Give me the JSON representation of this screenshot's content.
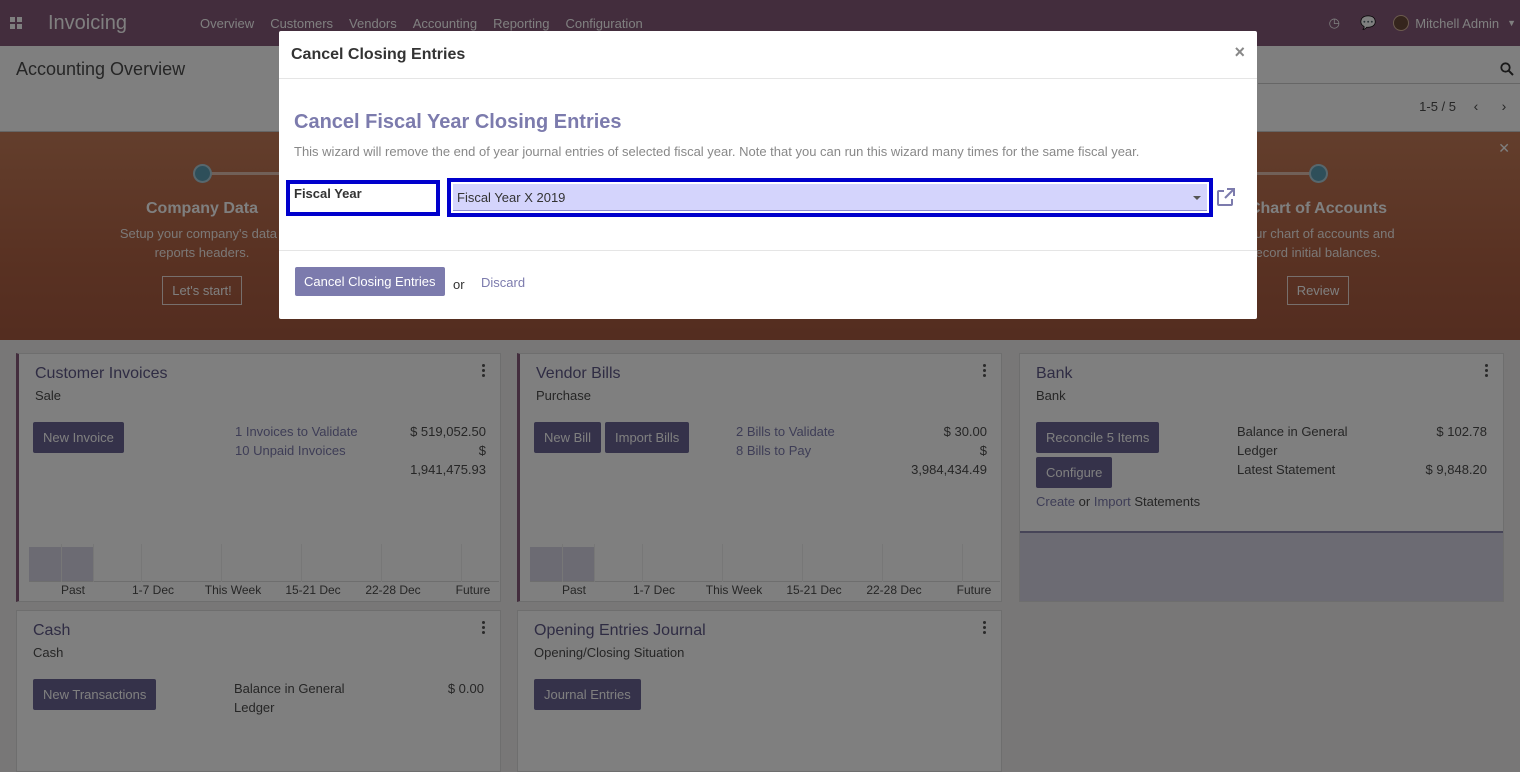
{
  "navbar": {
    "brand": "Invoicing",
    "menu": [
      "Overview",
      "Customers",
      "Vendors",
      "Accounting",
      "Reporting",
      "Configuration"
    ],
    "user_name": "Mitchell Admin",
    "icons": [
      "apps-grid-icon",
      "clock-icon",
      "chat-icon"
    ]
  },
  "control_panel": {
    "breadcrumb": "Accounting Overview",
    "pager": "1-5 / 5"
  },
  "banner": {
    "steps": [
      {
        "title": "Company Data",
        "desc_line1": "Setup your company's data f",
        "desc_line2": "reports headers.",
        "button": "Let's start!"
      },
      {
        "title": "Chart of Accounts",
        "desc_line1": "your chart of accounts and",
        "desc_line2": "ecord initial balances.",
        "button": "Review"
      }
    ]
  },
  "cards": {
    "customer_invoices": {
      "title": "Customer Invoices",
      "subtitle": "Sale",
      "button": "New Invoice",
      "link1": "1 Invoices to Validate",
      "link2": "10 Unpaid Invoices",
      "amount1": "$ 519,052.50",
      "amount2_a": "$",
      "amount2_b": "1,941,475.93",
      "graph_labels": [
        "Past",
        "1-7 Dec",
        "This Week",
        "15-21 Dec",
        "22-28 Dec",
        "Future"
      ]
    },
    "vendor_bills": {
      "title": "Vendor Bills",
      "subtitle": "Purchase",
      "button1": "New Bill",
      "button2": "Import Bills",
      "link1": "2 Bills to Validate",
      "link2": "8 Bills to Pay",
      "amount1": "$ 30.00",
      "amount2_a": "$",
      "amount2_b": "3,984,434.49",
      "graph_labels": [
        "Past",
        "1-7 Dec",
        "This Week",
        "15-21 Dec",
        "22-28 Dec",
        "Future"
      ]
    },
    "bank": {
      "title": "Bank",
      "subtitle": "Bank",
      "button1": "Reconcile 5 Items",
      "button2": "Configure",
      "label1_a": "Balance in General",
      "label1_b": "Ledger",
      "amount1": "$ 102.78",
      "label2": "Latest Statement",
      "amount2": "$ 9,848.20",
      "create": "Create",
      "or": "or",
      "import": "Import",
      "statements": "Statements"
    },
    "cash": {
      "title": "Cash",
      "subtitle": "Cash",
      "button": "New Transactions",
      "label1_a": "Balance in General",
      "label1_b": "Ledger",
      "amount1": "$ 0.00"
    },
    "opening": {
      "title": "Opening Entries Journal",
      "subtitle": "Opening/Closing Situation",
      "button": "Journal Entries"
    }
  },
  "modal": {
    "title": "Cancel Closing Entries",
    "close": "×",
    "wizard_title": "Cancel Fiscal Year Closing Entries",
    "description": "This wizard will remove the end of year journal entries of selected fiscal year. Note that you can run this wizard many times for the same fiscal year.",
    "field_label": "Fiscal Year",
    "field_value": "Fiscal Year X 2019",
    "primary_button": "Cancel Closing Entries",
    "or": "or",
    "discard": "Discard"
  },
  "colors": {
    "brand": "#875a7b",
    "primary": "#7c7bad",
    "highlight_border": "#0000cc",
    "highlight_fill": "#d4d4fc"
  }
}
